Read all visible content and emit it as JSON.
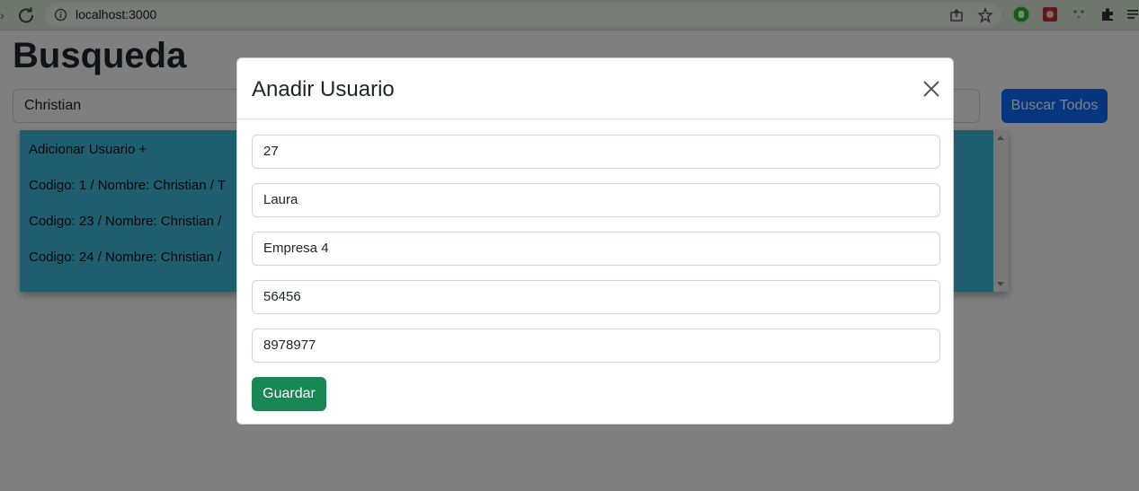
{
  "browser": {
    "url": "localhost:3000",
    "icons": [
      "back-arrow-icon",
      "reload-icon",
      "info-icon",
      "share-icon",
      "star-icon",
      "extension-green-icon",
      "extension-red-icon",
      "extension-dots-icon",
      "puzzle-icon",
      "reading-list-icon"
    ]
  },
  "page": {
    "title": "Busqueda",
    "search_value": "Christian",
    "search_all_label": "Buscar Todos",
    "results": [
      "Adicionar Usuario +",
      "Codigo: 1 / Nombre: Christian / T",
      "Codigo: 23 / Nombre: Christian /",
      "Codigo: 24 / Nombre: Christian /"
    ]
  },
  "modal": {
    "title": "Anadir Usuario",
    "fields": [
      "27",
      "Laura",
      "Empresa 4",
      "56456",
      "8978977"
    ],
    "save_label": "Guardar"
  },
  "colors": {
    "primary": "#0d6efd",
    "success": "#198754",
    "results_bg": "#3fbcdf",
    "browser_bar": "#dcecdc"
  }
}
